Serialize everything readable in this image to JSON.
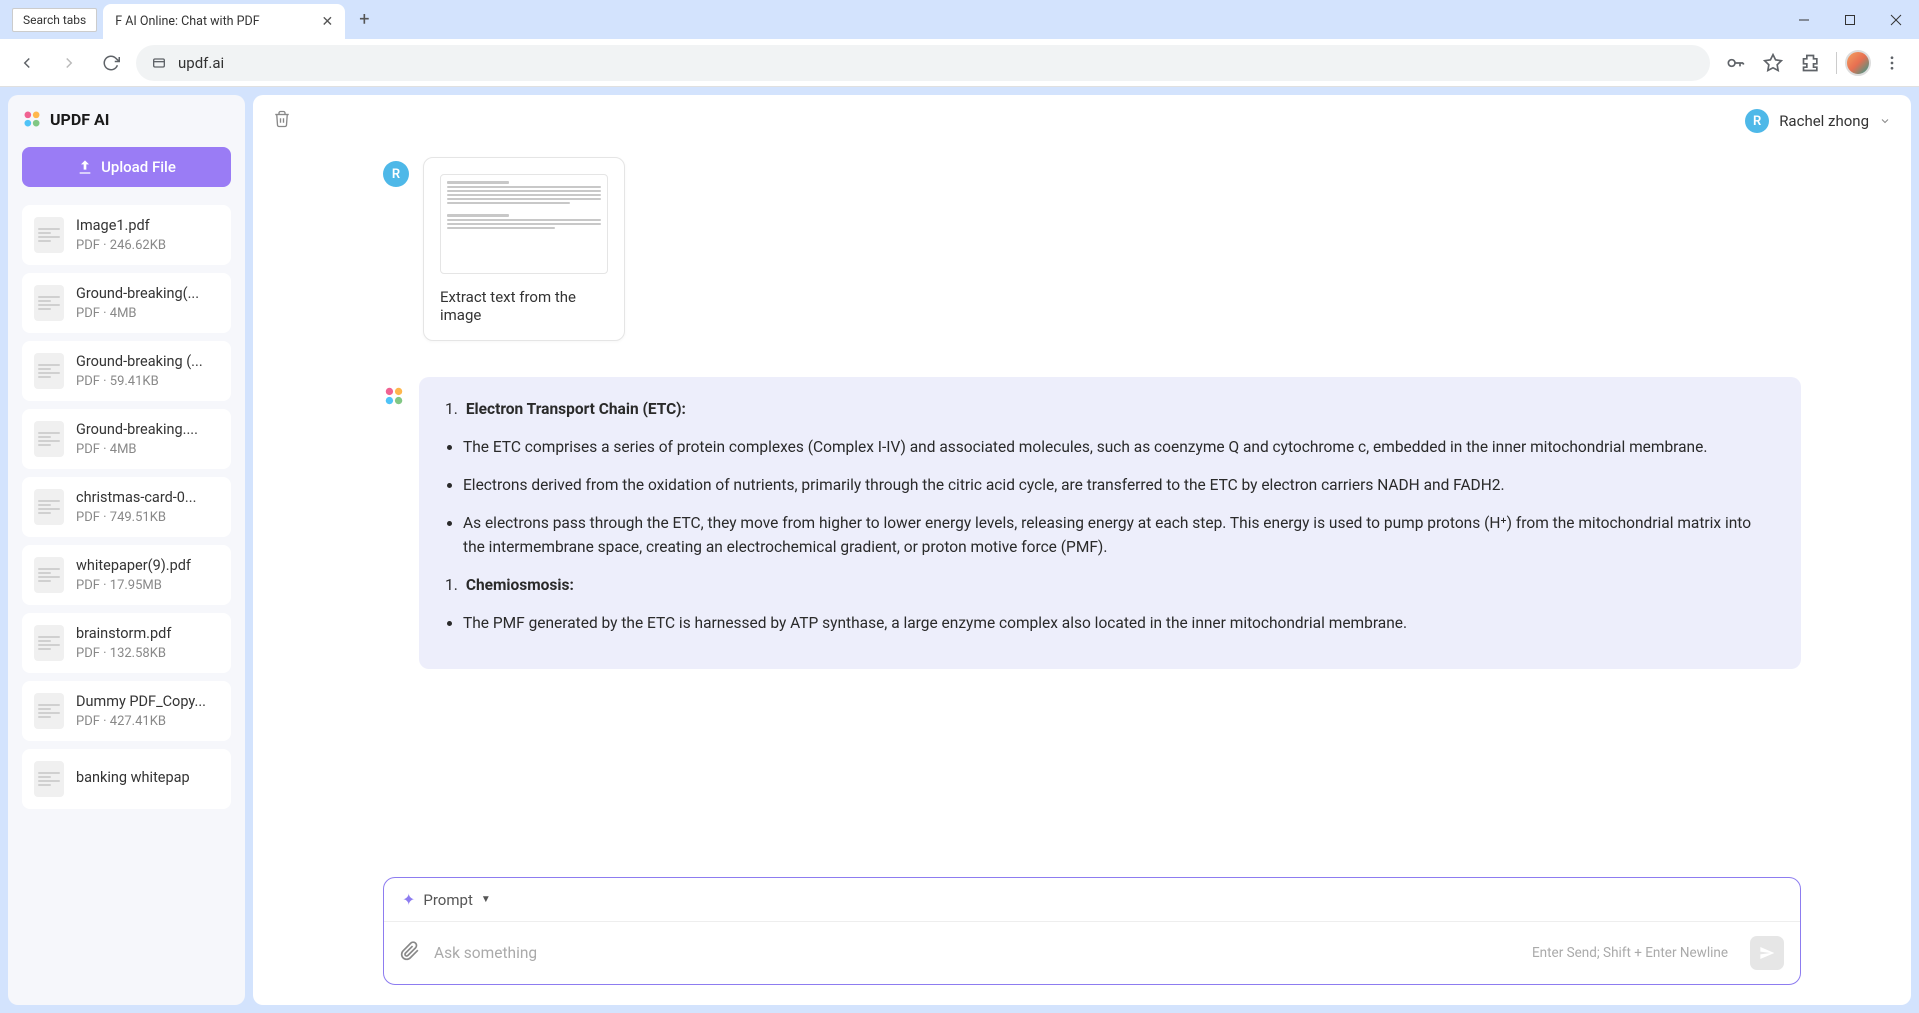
{
  "browser": {
    "search_tabs_tooltip": "Search tabs",
    "tab_title": "F AI Online: Chat with PDF",
    "url": "updf.ai"
  },
  "sidebar": {
    "app_name": "UPDF AI",
    "upload_label": "Upload File",
    "files": [
      {
        "name": "Image1.pdf",
        "meta": "PDF · 246.62KB"
      },
      {
        "name": "Ground-breaking(...",
        "meta": "PDF · 4MB"
      },
      {
        "name": "Ground-breaking (...",
        "meta": "PDF · 59.41KB"
      },
      {
        "name": "Ground-breaking....",
        "meta": "PDF · 4MB"
      },
      {
        "name": "christmas-card-0...",
        "meta": "PDF · 749.51KB"
      },
      {
        "name": "whitepaper(9).pdf",
        "meta": "PDF · 17.95MB"
      },
      {
        "name": "brainstorm.pdf",
        "meta": "PDF · 132.58KB"
      },
      {
        "name": "Dummy PDF_Copy...",
        "meta": "PDF · 427.41KB"
      },
      {
        "name": "banking whitepap",
        "meta": ""
      }
    ]
  },
  "header": {
    "user_initial": "R",
    "user_name": "Rachel zhong"
  },
  "chat": {
    "user_avatar_initial": "R",
    "user_message": "Extract text from the image",
    "ai_response": {
      "section1_num": "1.",
      "section1_title": "Electron Transport Chain (ETC):",
      "bullets1": [
        "The ETC comprises a series of protein complexes (Complex I-IV) and associated molecules, such as coenzyme Q and cytochrome c, embedded in the inner mitochondrial membrane.",
        "Electrons derived from the oxidation of nutrients, primarily through the citric acid cycle, are transferred to the ETC by electron carriers NADH and FADH2.",
        "As electrons pass through the ETC, they move from higher to lower energy levels, releasing energy at each step. This energy is used to pump protons (H⁺) from the mitochondrial matrix into the intermembrane space, creating an electrochemical gradient, or proton motive force (PMF)."
      ],
      "section2_num": "1.",
      "section2_title": "Chemiosmosis:",
      "bullets2": [
        "The PMF generated by the ETC is harnessed by ATP synthase, a large enzyme complex also located in the inner mitochondrial membrane."
      ]
    }
  },
  "input": {
    "prompt_label": "Prompt",
    "placeholder": "Ask something",
    "hint": "Enter Send; Shift + Enter Newline"
  }
}
